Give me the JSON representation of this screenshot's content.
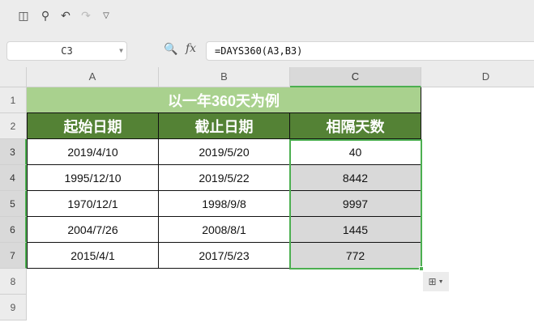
{
  "toolbar": {
    "icons": [
      "save-icon",
      "print-preview-icon",
      "undo-icon",
      "redo-icon",
      "customize-icon"
    ]
  },
  "formula_bar": {
    "name_box": "C3",
    "fx_label": "fx",
    "formula": "=DAYS360(A3,B3)"
  },
  "columns": [
    "A",
    "B",
    "C",
    "D"
  ],
  "rows": [
    "1",
    "2",
    "3",
    "4",
    "5",
    "6",
    "7",
    "8",
    "9"
  ],
  "sheet": {
    "title": "以一年360天为例",
    "headers": [
      "起始日期",
      "截止日期",
      "相隔天数"
    ],
    "data": [
      [
        "2019/4/10",
        "2019/5/20",
        "40"
      ],
      [
        "1995/12/10",
        "2019/5/22",
        "8442"
      ],
      [
        "1970/12/1",
        "1998/9/8",
        "9997"
      ],
      [
        "2004/7/26",
        "2008/8/1",
        "1445"
      ],
      [
        "2015/4/1",
        "2017/5/23",
        "772"
      ]
    ]
  },
  "colors": {
    "title_bg": "#a9d18e",
    "header_bg": "#548235",
    "selection": "#4caf50"
  }
}
